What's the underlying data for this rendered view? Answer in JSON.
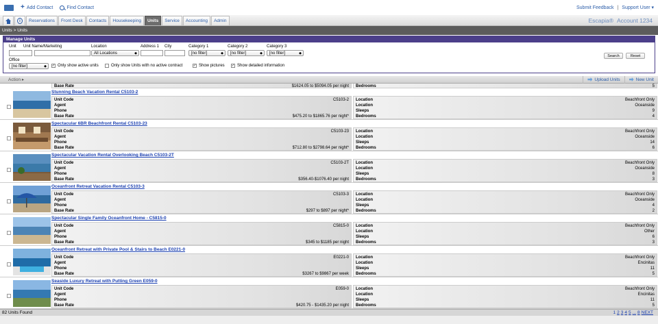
{
  "topbar": {
    "add_contact": "Add Contact",
    "find_contact": "Find Contact",
    "submit_feedback": "Submit Feedback",
    "separator": "|",
    "support_user": "Support User ▾"
  },
  "nav": {
    "tabs": [
      "Reservations",
      "Front Desk",
      "Contacts",
      "Housekeeping",
      "Units",
      "Service",
      "Accounting",
      "Admin"
    ],
    "active_tab": "Units",
    "brand": "Escapia®",
    "account": "Account 1234"
  },
  "breadcrumb": "Units > Units",
  "manage": {
    "title": "Manage Units",
    "labels": {
      "unit": "Unit",
      "unit_name": "Unit Name/Marketing",
      "location": "Location",
      "address1": "Address 1",
      "city": "City",
      "category1": "Category 1",
      "category2": "Category 2",
      "category3": "Category 3",
      "office": "Office"
    },
    "values": {
      "location": "All Locations",
      "category1": "[no filter]",
      "category2": "[no filter]",
      "category3": "[no filter]",
      "office": "[no filter]"
    },
    "checkboxes": {
      "active_units": "Only show active units",
      "no_contract": "Only show Units with no active contract",
      "show_pictures": "Show pictures",
      "show_detailed": "Show detailed information"
    },
    "search_label": "Search",
    "reset_label": "Reset"
  },
  "actionbar": {
    "action": "Action ▸",
    "upload": "Upload Units",
    "new_unit": "New Unit"
  },
  "partial_row": {
    "label": "Base Rate",
    "value": "$1624.05 to $5094.05 per night",
    "right_label": "Bedrooms",
    "right_value": "5"
  },
  "field_labels": {
    "unit_code": "Unit Code",
    "agent": "Agent",
    "phone": "Phone",
    "base_rate": "Base Rate",
    "location": "Location",
    "sleeps": "Sleeps",
    "bedrooms": "Bedrooms"
  },
  "units": [
    {
      "title": "Stunning Beach Vacation Rental C5103-2",
      "code": "C5103-2",
      "rate": "$475.20 to $1865.76 per night*",
      "location1": "Beachfront Only",
      "location2": "Oceanside",
      "sleeps": "9",
      "bedrooms": "4",
      "thumb": "beach"
    },
    {
      "title": "Spectacular 6BR Beachfront Rental C5103-23",
      "code": "C5103-23",
      "rate": "$712.80 to $2798.64 per night*",
      "location1": "Beachfront Only",
      "location2": "Oceanside",
      "sleeps": "14",
      "bedrooms": "6",
      "thumb": "kitchen"
    },
    {
      "title": "Spectacular Vacation Rental Overlooking Beach C5103-2T",
      "code": "C5103-2T",
      "rate": "$356.40-$1076.40 per night",
      "location1": "Beachfront Only",
      "location2": "Oceanside",
      "sleeps": "8",
      "bedrooms": "3",
      "thumb": "deck"
    },
    {
      "title": "Oceanfront Retreat Vacation Rental C5103-3",
      "code": "C5103-3",
      "rate": "$297 to $897 per night*",
      "location1": "Beachfront Only",
      "location2": "Oceanside",
      "sleeps": "4",
      "bedrooms": "2",
      "thumb": "umbrella"
    },
    {
      "title": "Spectacular Single Family Oceanfront Home - C5815-0",
      "code": "C5815-0",
      "rate": "$345 to $1185 per night",
      "location1": "Beachfront Only",
      "location2": "Other",
      "sleeps": "6",
      "bedrooms": "3",
      "thumb": "shore"
    },
    {
      "title": "Oceanfront Retreat with Private Pool & Stairs to Beach E0221-0",
      "code": "E0221-0",
      "rate": "$3267 to $9867 per week",
      "location1": "Beachfront Only",
      "location2": "Encinitas",
      "sleeps": "11",
      "bedrooms": "5",
      "thumb": "pool"
    },
    {
      "title": "Seaside Luxury Retreat with Putting Green E059-0",
      "code": "E059-0",
      "rate": "$420.75 - $1435.20 per night",
      "location1": "Beachfront Only",
      "location2": "Encinitas",
      "sleeps": "11",
      "bedrooms": "5",
      "thumb": "cliff"
    }
  ],
  "footer": {
    "count": "82 Units Found",
    "pages": [
      "1",
      "2",
      "3",
      "4",
      "5",
      "...",
      "8",
      "NEXT"
    ]
  },
  "colors": {
    "link": "#1a3fb0",
    "panel_header": "#4b3f8a",
    "active_tab": "#6d6d6d"
  }
}
